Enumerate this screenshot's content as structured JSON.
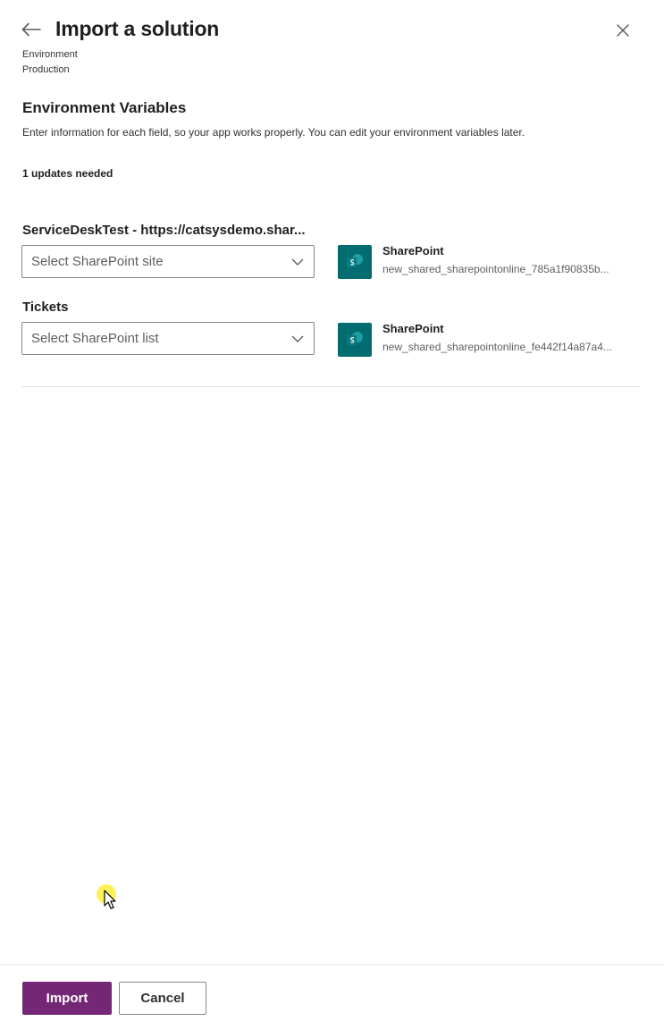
{
  "header": {
    "title": "Import a solution",
    "back_icon": "arrow-left-icon",
    "close_icon": "close-icon"
  },
  "environment": {
    "label": "Environment",
    "value": "Production"
  },
  "section": {
    "heading": "Environment Variables",
    "description": "Enter information for each field, so your app works properly. You can edit your environment variables later.",
    "updates_needed": "1 updates needed"
  },
  "variables": [
    {
      "label": "ServiceDeskTest - https://catsysdemo.shar...",
      "placeholder": "Select SharePoint site",
      "connection_name": "SharePoint",
      "connection_id": "new_shared_sharepointonline_785a1f90835b..."
    },
    {
      "label": "Tickets",
      "placeholder": "Select SharePoint list",
      "connection_name": "SharePoint",
      "connection_id": "new_shared_sharepointonline_fe442f14a87a4..."
    }
  ],
  "footer": {
    "import_label": "Import",
    "cancel_label": "Cancel"
  },
  "colors": {
    "primary": "#742774",
    "sharepoint": "#036c70",
    "cursor_highlight": "#fff03c"
  }
}
